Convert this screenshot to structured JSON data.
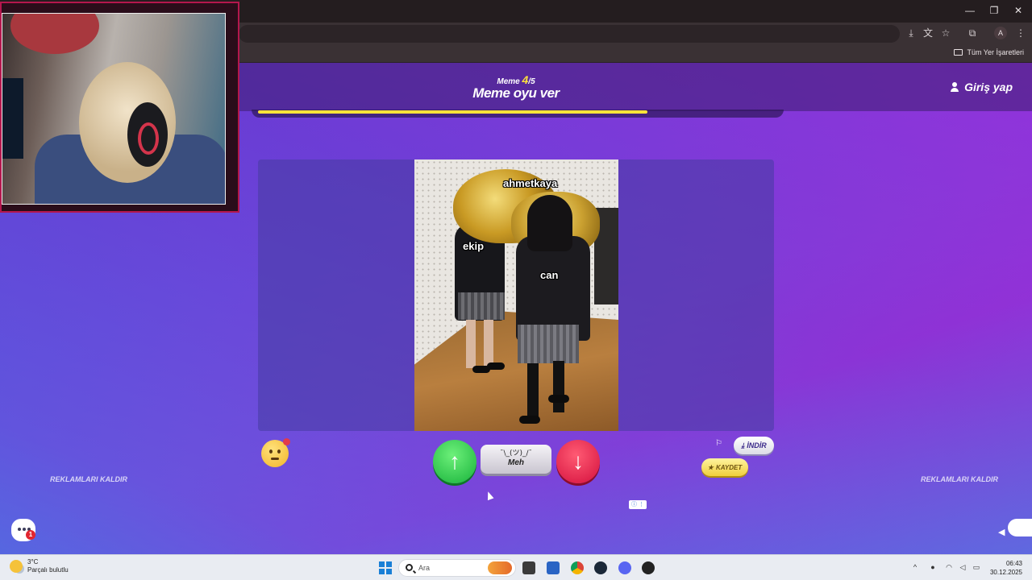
{
  "browser": {
    "bookmarks_all_label": "Tüm Yer İşaretleri",
    "profile_initial": "A"
  },
  "game": {
    "counter_prefix": "Meme",
    "counter_current": "4",
    "counter_total": "/5",
    "title": "Meme oyu ver",
    "login_label": "Giriş yap",
    "progress": 0.75
  },
  "meme": {
    "captions": {
      "top": "ahmetkaya",
      "left": "ekip",
      "right": "can"
    }
  },
  "vote": {
    "meh_face": "¯\\_(ツ)_/¯",
    "meh_label": "Meh",
    "download_label": "İNDİR",
    "save_label": "KAYDET"
  },
  "ads": {
    "remove_left": "REKLAMLARI KALDIR",
    "remove_right": "REKLAMLARI KALDIR"
  },
  "chat": {
    "badge_count": "1"
  },
  "taskbar": {
    "weather_temp": "3°C",
    "weather_desc": "Parçalı bulutlu",
    "search_placeholder": "Ara",
    "time": "06:43",
    "date": "30.12.2025"
  },
  "colors": {
    "accent_yellow": "#ffe23a",
    "up_green": "#17b23a",
    "down_red": "#d4103d"
  }
}
